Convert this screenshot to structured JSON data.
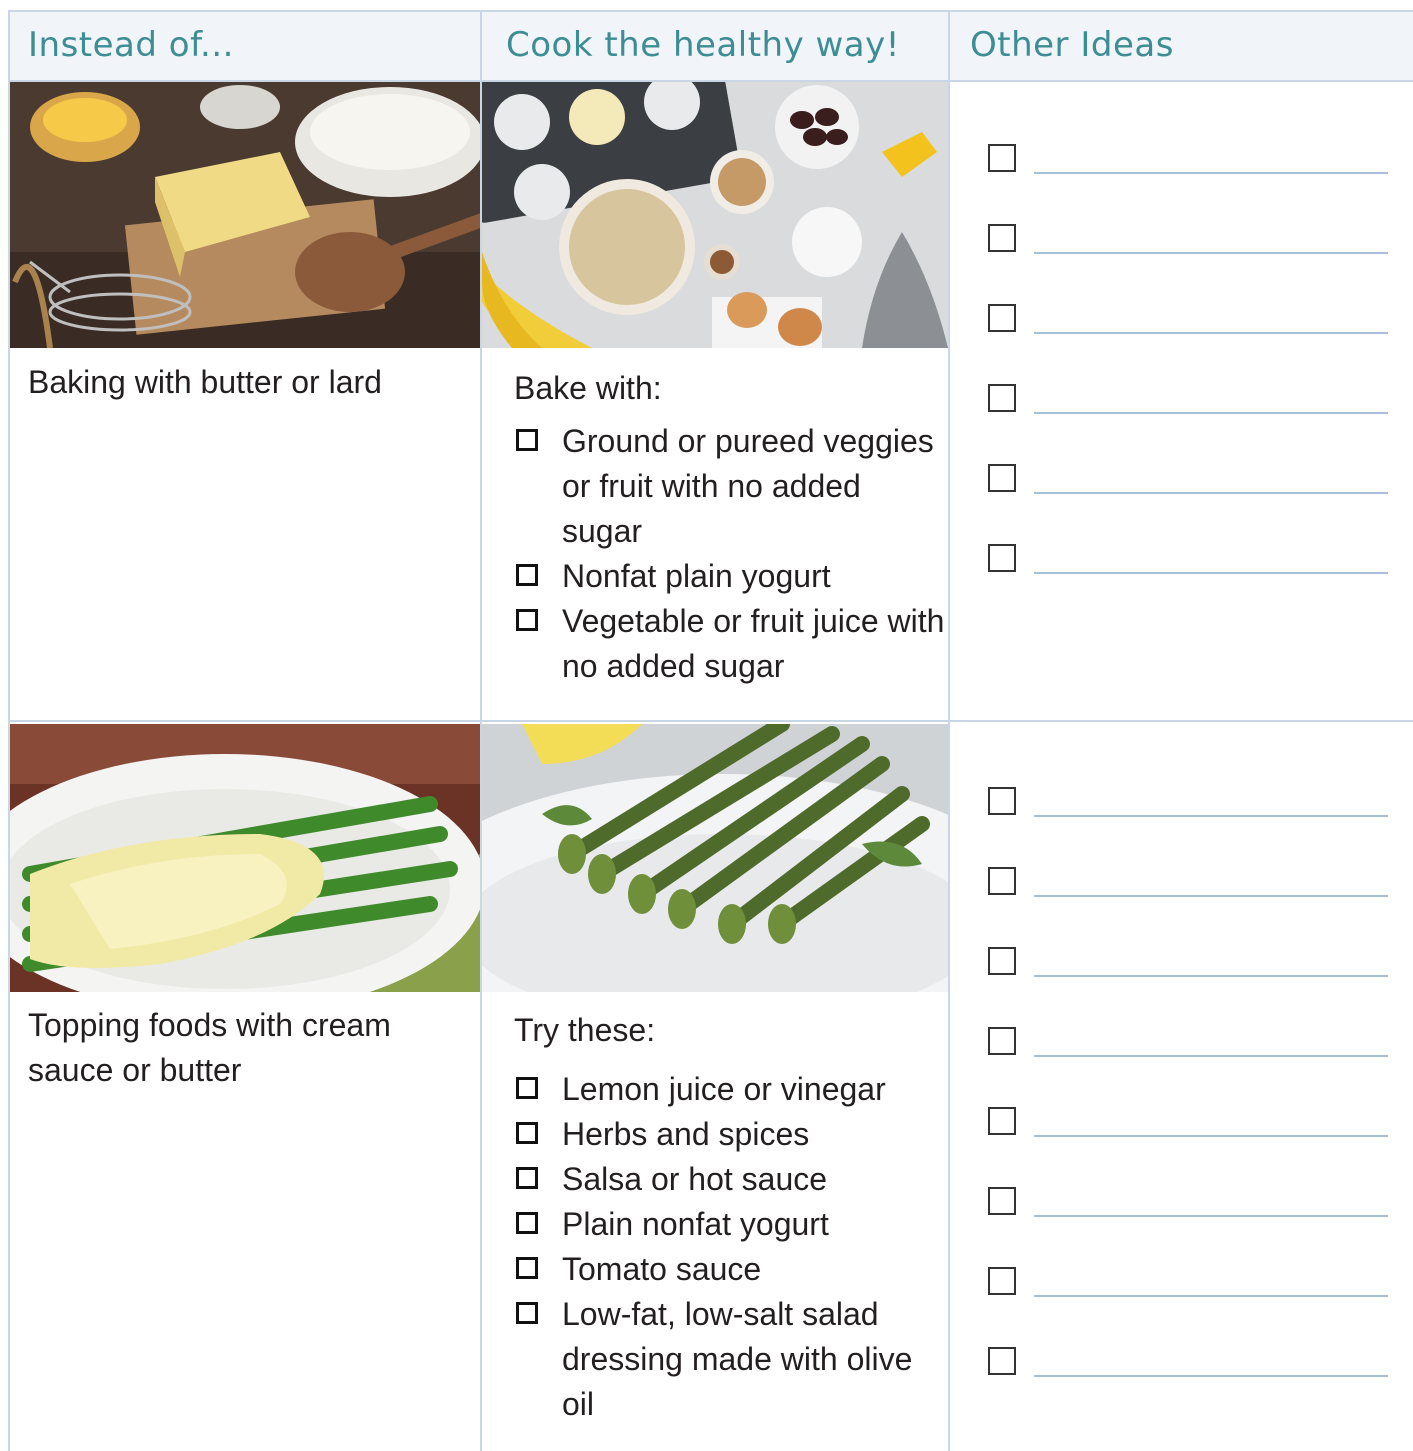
{
  "headers": {
    "instead": "Instead of...",
    "healthy": "Cook the healthy way!",
    "other": "Other Ideas"
  },
  "rows": [
    {
      "instead_image": "baking-ingredients-photo",
      "healthy_image": "healthy-baking-ingredients-photo",
      "instead_text": "Baking with butter or lard",
      "healthy_intro": "Bake with:",
      "healthy_items": [
        "Ground or pureed veggies or fruit with no added sugar",
        "Nonfat plain yogurt",
        "Vegetable or fruit juice with no added sugar"
      ],
      "idea_lines": 6
    },
    {
      "instead_image": "asparagus-cream-sauce-photo",
      "healthy_image": "asparagus-lemon-photo",
      "instead_text": "Topping foods with cream sauce or butter",
      "healthy_intro": "Try these:",
      "healthy_items": [
        "Lemon juice or vinegar",
        "Herbs and spices",
        "Salsa or hot sauce",
        "Plain nonfat yogurt",
        "Tomato sauce",
        "Low-fat, low-salt salad dressing made with olive oil"
      ],
      "idea_lines": 8
    }
  ],
  "colors": {
    "header_text": "#3c8d94",
    "header_bg": "#f1f4f8",
    "grid_line": "#c8d6e5",
    "write_line": "#a9bfd6"
  }
}
